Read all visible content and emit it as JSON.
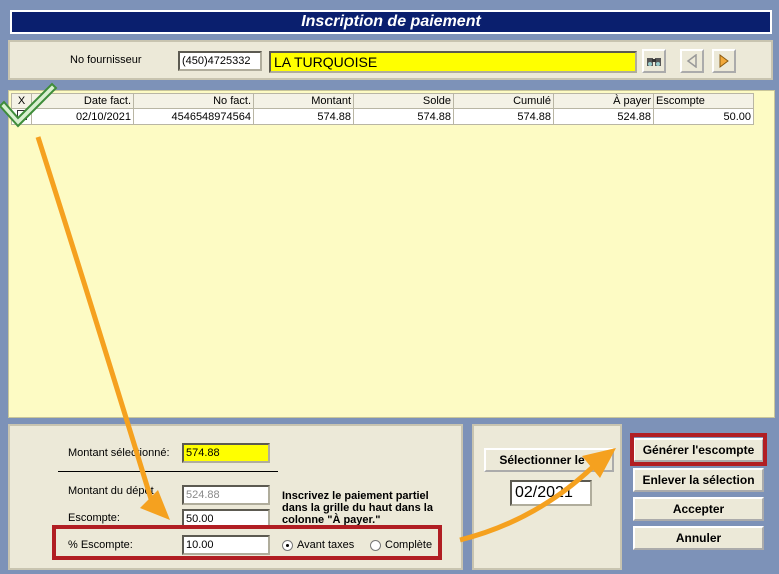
{
  "window": {
    "title": "Inscription de paiement"
  },
  "supplier": {
    "label": "No fournisseur",
    "number": "(450)4725332",
    "name": "LA TURQUOISE"
  },
  "toolbar": {
    "lookup_icon": "binoculars-icon",
    "prev_icon": "triangle-left-icon",
    "next_icon": "triangle-right-icon"
  },
  "grid": {
    "columns": [
      "X",
      "Date fact.",
      "No fact.",
      "Montant",
      "Solde",
      "Cumulé",
      "À payer",
      "Escompte"
    ],
    "rows": [
      [
        "",
        "02/10/2021",
        "4546548974564",
        "574.88",
        "574.88",
        "574.88",
        "524.88",
        "50.00"
      ]
    ]
  },
  "summary": {
    "selected_label": "Montant sélectionné:",
    "selected_value": "574.88",
    "deposit_label": "Montant du dépôt",
    "deposit_value": "524.88",
    "discount_label": "Escompte:",
    "discount_value": "50.00",
    "pct_label": "% Escompte:",
    "pct_value": "10.00",
    "instructions": "Inscrivez le paiement partiel dans la grille du haut dans la colonne \"À payer.\"",
    "radio_before_tax": "Avant taxes",
    "radio_full": "Complète"
  },
  "period": {
    "select_button": "Sélectionner le m",
    "date_value": "02/2021"
  },
  "actions": {
    "generate": "Générer l'escompte",
    "remove": "Enlever la sélection",
    "accept": "Accepter",
    "cancel": "Annuler"
  },
  "colors": {
    "title_bg": "#0a1f6e",
    "grid_bg": "#fdfbc4",
    "highlight_red": "#b11e23",
    "arrow_orange": "#f5a11f"
  }
}
